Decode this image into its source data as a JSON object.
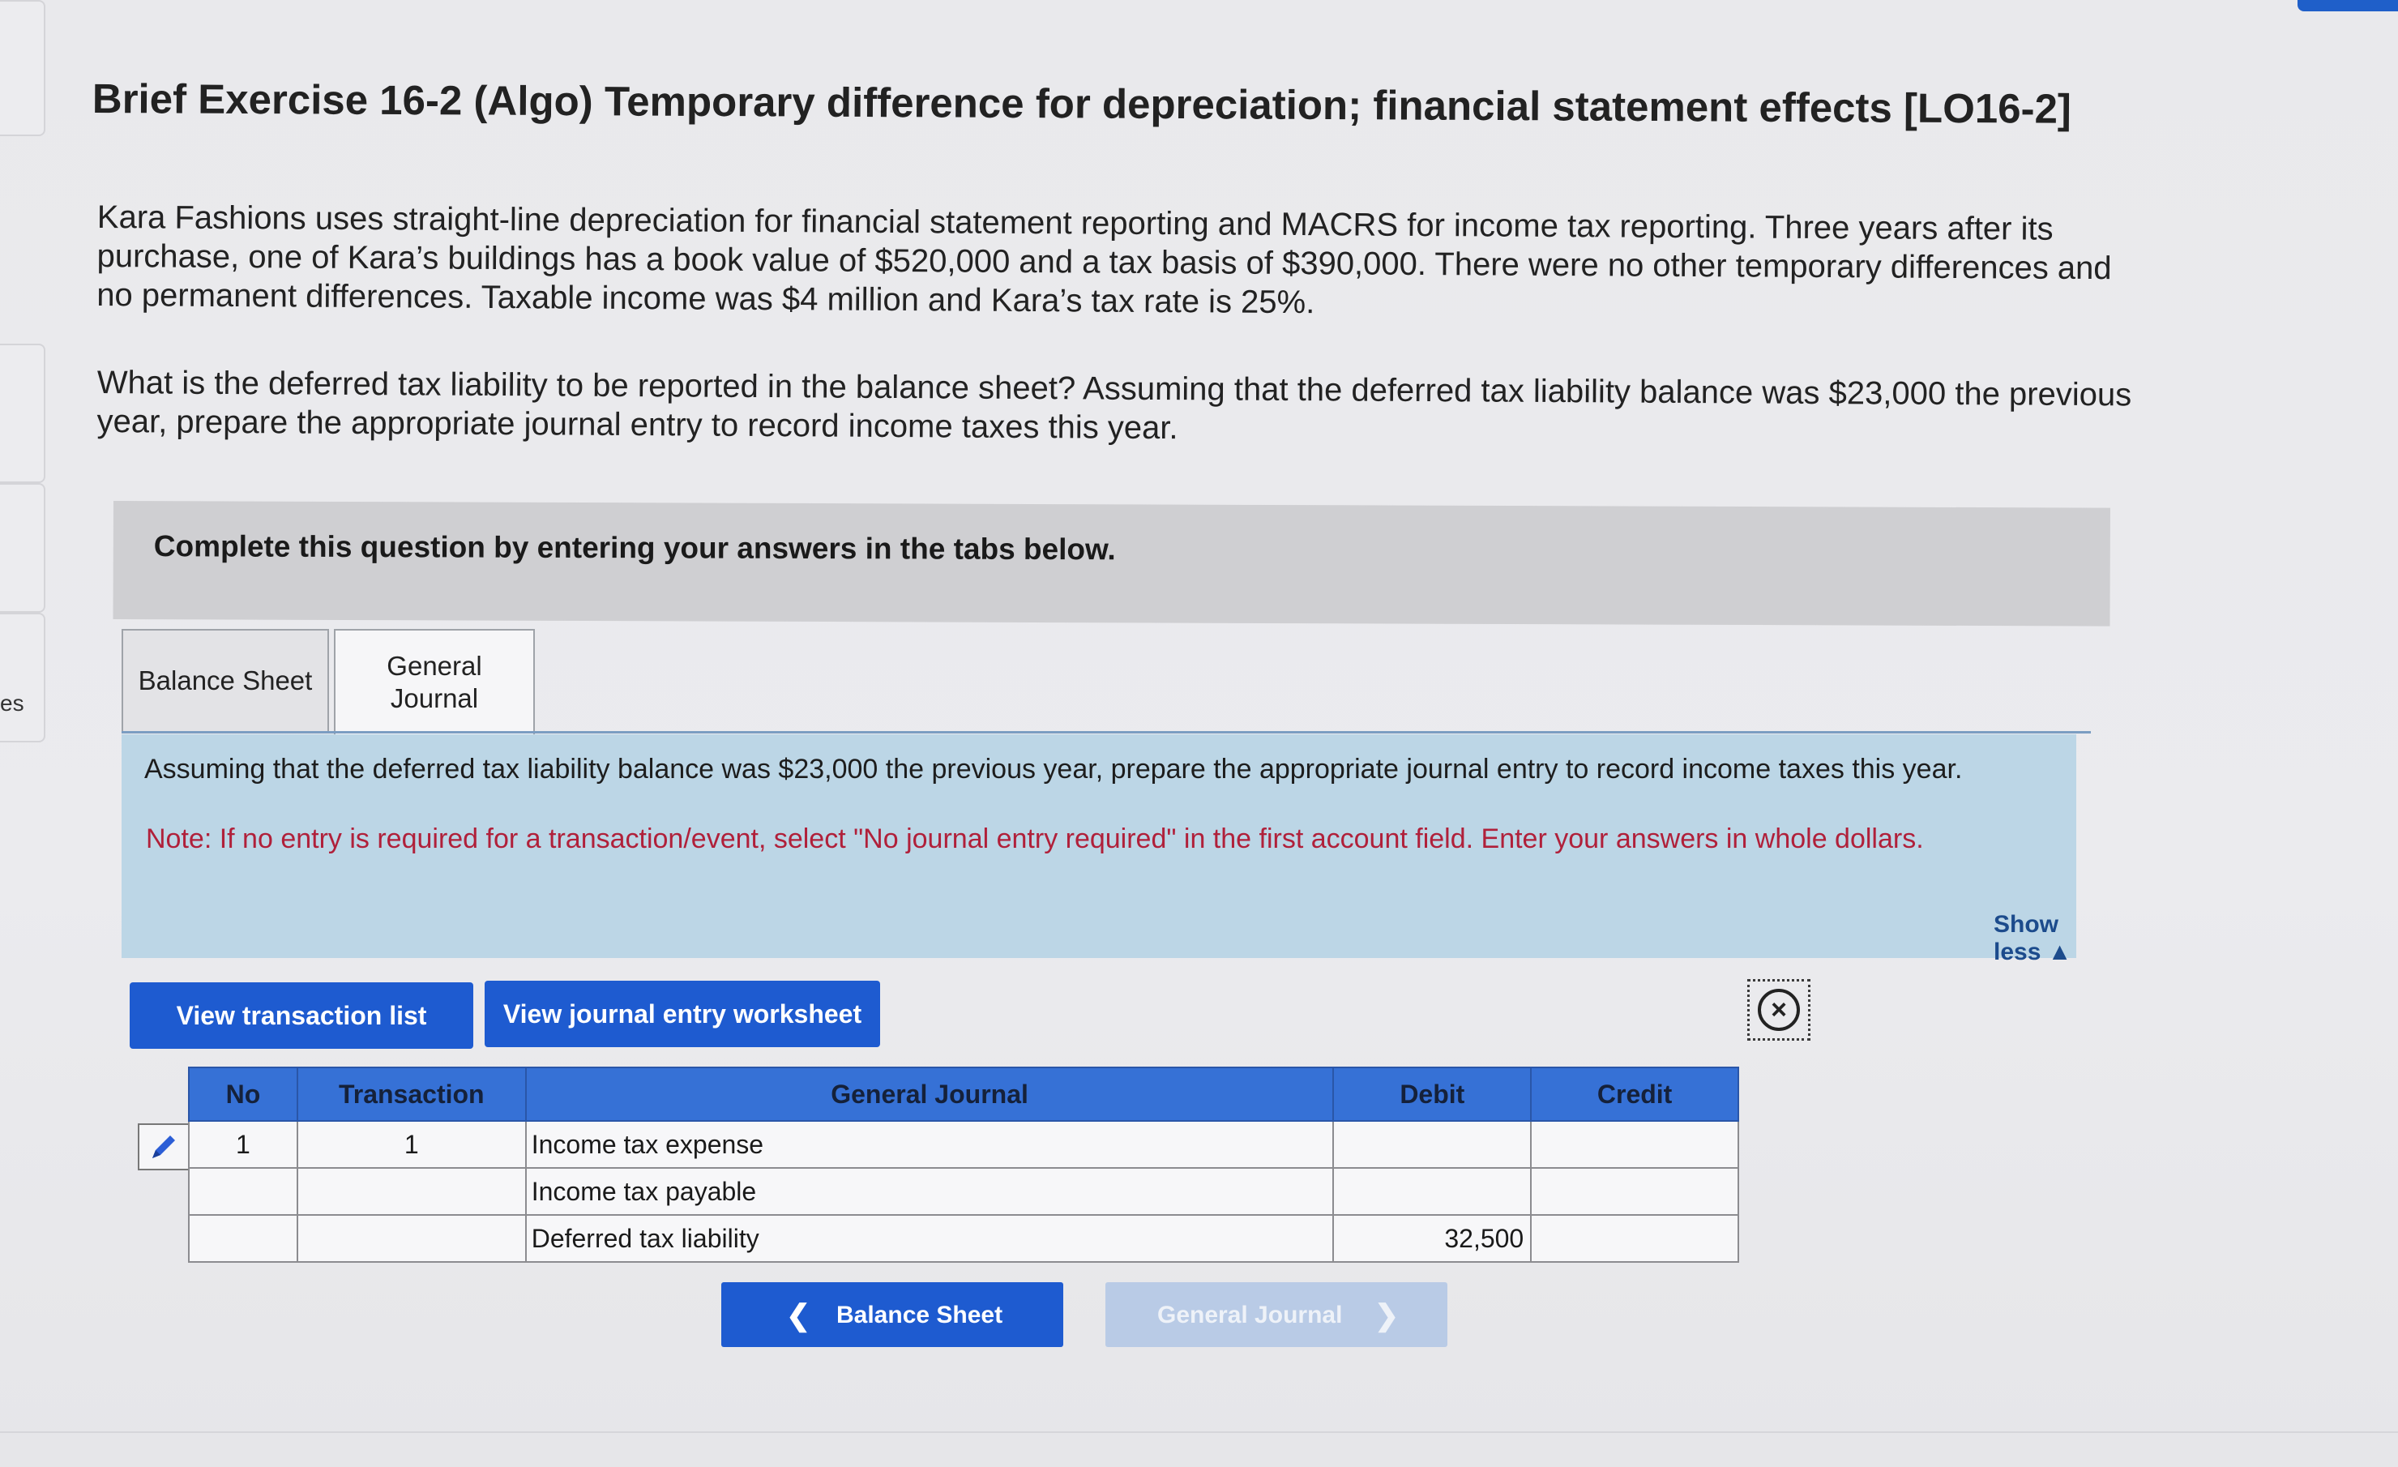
{
  "sidebar": {
    "partial_label": "es"
  },
  "title": "Brief Exercise 16-2 (Algo) Temporary difference for depreciation; financial statement effects [LO16-2]",
  "problem": {
    "paragraph1": "Kara Fashions uses straight-line depreciation for financial statement reporting and MACRS for income tax reporting. Three years after its purchase, one of Kara’s buildings has a book value of $520,000 and a tax basis of $390,000. There were no other temporary differences and no permanent differences. Taxable income was $4 million and Kara’s tax rate is 25%.",
    "paragraph2": "What is the deferred tax liability to be reported in the balance sheet? Assuming that the deferred tax liability balance was $23,000 the previous year, prepare the appropriate journal entry to record income taxes this year."
  },
  "banner": "Complete this question by entering your answers in the tabs below.",
  "tabs": [
    {
      "label": "Balance Sheet",
      "active": false
    },
    {
      "label": "General Journal",
      "active": true
    }
  ],
  "instructions": {
    "main": "Assuming that the deferred tax liability balance was $23,000 the previous year, prepare the appropriate journal entry to record income taxes this year.",
    "note": "Note: If no entry is required for a transaction/event, select \"No journal entry required\" in the first account field. Enter your answers in whole dollars.",
    "show_less": "Show less ▲"
  },
  "buttons": {
    "view_transaction_list": "View transaction list",
    "view_journal_worksheet": "View journal entry worksheet"
  },
  "journal": {
    "headers": {
      "no": "No",
      "transaction": "Transaction",
      "general_journal": "General Journal",
      "debit": "Debit",
      "credit": "Credit"
    },
    "rows": [
      {
        "no": "1",
        "transaction": "1",
        "account": "Income tax expense",
        "debit": "",
        "credit": ""
      },
      {
        "no": "",
        "transaction": "",
        "account": "Income tax payable",
        "debit": "",
        "credit": ""
      },
      {
        "no": "",
        "transaction": "",
        "account": "Deferred tax liability",
        "debit": "32,500",
        "credit": ""
      }
    ]
  },
  "navigation": {
    "prev_label": "Balance Sheet",
    "next_label": "General Journal",
    "prev_icon": "chevron-left-icon",
    "next_icon": "chevron-right-icon"
  },
  "colors": {
    "primary_button": "#1e5bd0",
    "table_header": "#3671d6",
    "instruction_bg": "#bcd6e6",
    "note_text": "#b0203a",
    "banner_bg": "#cfcfd2"
  }
}
